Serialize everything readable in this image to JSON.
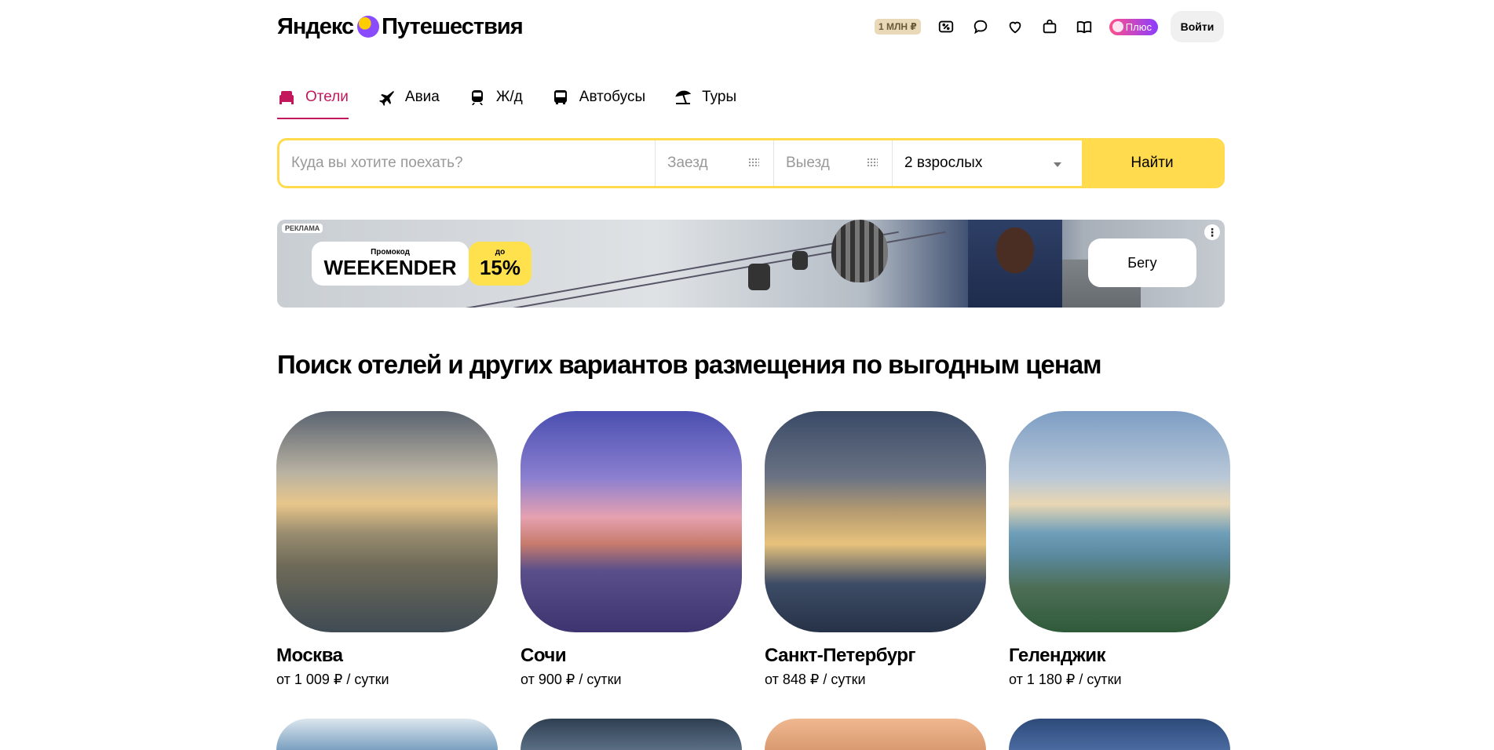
{
  "header": {
    "logo_part1": "Яндекс",
    "logo_part2": "Путешествия",
    "badge_mln": "1 МЛН ₽",
    "plus_label": "Плюс",
    "login_label": "Войти"
  },
  "tabs": [
    {
      "label": "Отели",
      "icon": "bed-icon",
      "active": true
    },
    {
      "label": "Авиа",
      "icon": "plane-icon"
    },
    {
      "label": "Ж/д",
      "icon": "train-icon"
    },
    {
      "label": "Автобусы",
      "icon": "bus-icon"
    },
    {
      "label": "Туры",
      "icon": "beach-icon"
    }
  ],
  "search": {
    "where_placeholder": "Куда вы хотите поехать?",
    "checkin_placeholder": "Заезд",
    "checkout_placeholder": "Выезд",
    "guests_value": "2 взрослых",
    "find_label": "Найти"
  },
  "banner": {
    "ad_tag": "РЕКЛАМА",
    "promo_small": "Промокод",
    "promo_code": "WEEKENDER",
    "discount_small": "до",
    "discount_value": "15%",
    "cta": "Бегу"
  },
  "main": {
    "heading": "Поиск отелей и других вариантов размещения по выгодным ценам",
    "cities": [
      {
        "name": "Москва",
        "price": "от 1 009 ₽ / сутки"
      },
      {
        "name": "Сочи",
        "price": "от 900 ₽ / сутки"
      },
      {
        "name": "Санкт-Петербург",
        "price": "от 848 ₽ / сутки"
      },
      {
        "name": "Геленджик",
        "price": "от 1 180 ₽ / сутки"
      }
    ]
  },
  "colors": {
    "accent": "#c2185b",
    "search_yellow": "#ffdb4d"
  }
}
